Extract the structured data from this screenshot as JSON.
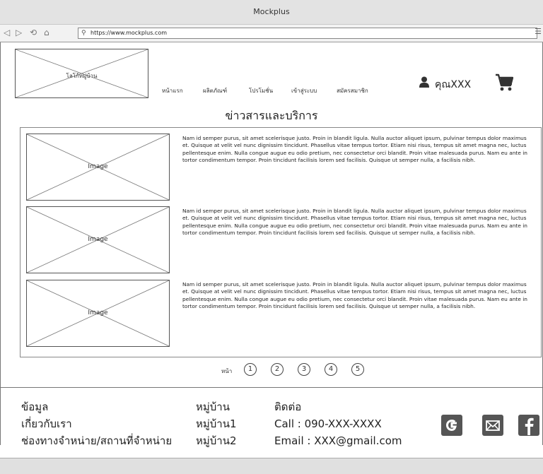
{
  "window": {
    "title": "Mockplus"
  },
  "browser": {
    "url": "https://www.mockplus.com",
    "icons": [
      "back-icon",
      "forward-icon",
      "refresh-icon",
      "home-icon",
      "search-icon",
      "menu-icon"
    ]
  },
  "header": {
    "logo_label": "โลโก้หมู่บ้าน",
    "nav": [
      "หน้าแรก",
      "ผลิตภัณฑ์",
      "โปรโมชั่น",
      "เข้าสู่ระบบ",
      "สมัครสมาชิก"
    ],
    "user_name": "คุณXXX",
    "icons": [
      "user-icon",
      "cart-icon"
    ]
  },
  "main": {
    "title": "ข่าวสารและบริการ",
    "items": [
      {
        "image_label": "Image",
        "text": "Nam id semper purus, sit amet scelerisque justo. Proin in blandit ligula. Nulla auctor aliquet ipsum, pulvinar tempus dolor maximus et. Quisque at velit vel nunc dignissim tincidunt. Phasellus vitae tempus tortor. Etiam nisi risus, tempus sit amet magna nec, luctus pellentesque enim. Nulla congue augue eu odio pretium, nec consectetur orci blandit. Proin vitae malesuada purus. Nam eu ante in tortor condimentum tempor. Proin tincidunt facilisis lorem sed facilisis. Quisque ut semper nulla, a facilisis nibh."
      },
      {
        "image_label": "Image",
        "text": "Nam id semper purus, sit amet scelerisque justo. Proin in blandit ligula. Nulla auctor aliquet ipsum, pulvinar tempus dolor maximus et. Quisque at velit vel nunc dignissim tincidunt. Phasellus vitae tempus tortor. Etiam nisi risus, tempus sit amet magna nec, luctus pellentesque enim. Nulla congue augue eu odio pretium, nec consectetur orci blandit. Proin vitae malesuada purus. Nam eu ante in tortor condimentum tempor. Proin tincidunt facilisis lorem sed facilisis. Quisque ut semper nulla, a facilisis nibh."
      },
      {
        "image_label": "Image",
        "text": "Nam id semper purus, sit amet scelerisque justo. Proin in blandit ligula. Nulla auctor aliquet ipsum, pulvinar tempus dolor maximus et. Quisque at velit vel nunc dignissim tincidunt. Phasellus vitae tempus tortor. Etiam nisi risus, tempus sit amet magna nec, luctus pellentesque enim. Nulla congue augue eu odio pretium, nec consectetur orci blandit. Proin vitae malesuada purus. Nam eu ante in tortor condimentum tempor. Proin tincidunt facilisis lorem sed facilisis. Quisque ut semper nulla, a facilisis nibh."
      }
    ]
  },
  "pagination": {
    "label": "หน้า",
    "pages": [
      "1",
      "2",
      "3",
      "4",
      "5"
    ]
  },
  "footer": {
    "col1": [
      "ข้อมูล",
      "เกี่ยวกับเรา",
      "ช่องทางจำหน่าย/สถานที่จำหน่าย"
    ],
    "col2": [
      "หมู่บ้าน",
      "หมู่บ้าน1",
      "หมู่บ้าน2"
    ],
    "col3": [
      "ติดต่อ",
      "Call : 090-XXX-XXXX",
      "Email : XXX@gmail.com"
    ],
    "social": [
      "google-icon",
      "mail-icon",
      "facebook-icon"
    ],
    "icon_color": "#555555"
  }
}
